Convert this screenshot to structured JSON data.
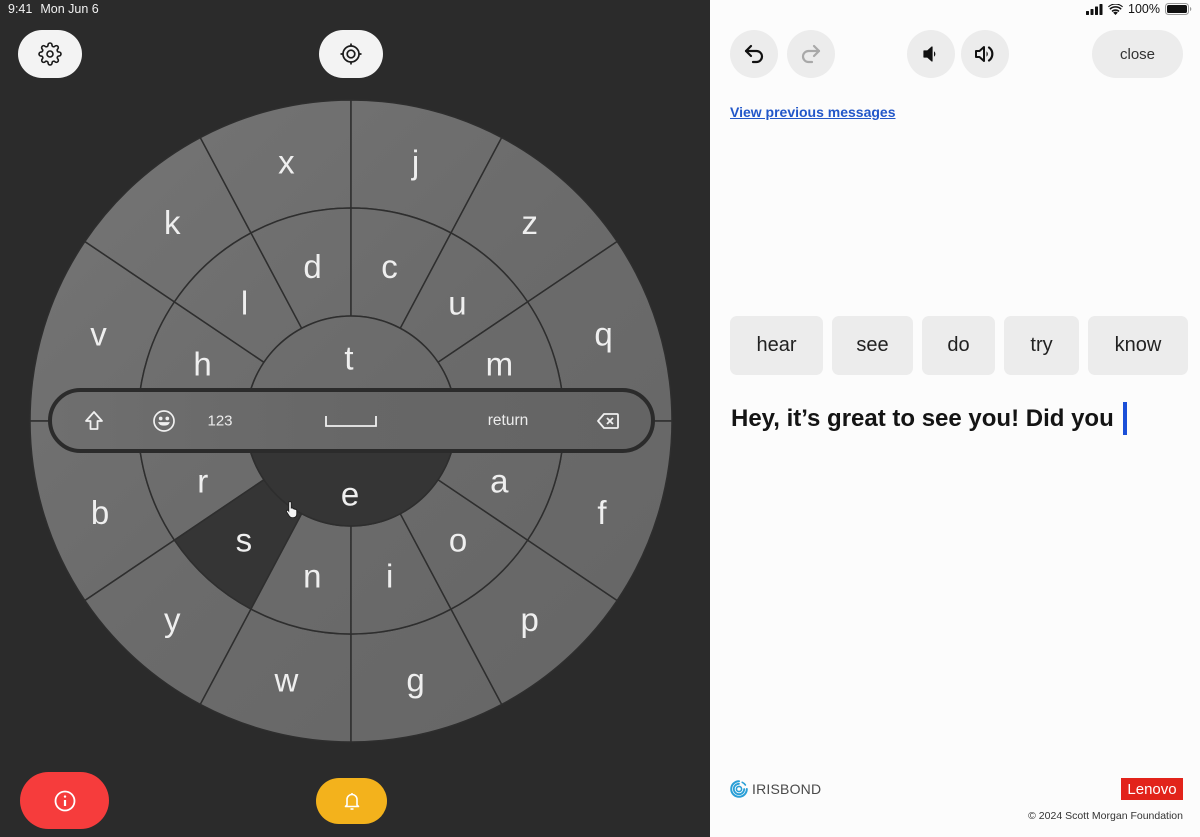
{
  "status_bar": {
    "time": "9:41",
    "date": "Mon Jun 6",
    "battery_percent": "100%",
    "icons": [
      "cellular-signal-icon",
      "wifi-icon",
      "battery-icon"
    ]
  },
  "left_panel": {
    "settings_button": {
      "icon": "gear-icon"
    },
    "recenter_button": {
      "icon": "target-icon"
    },
    "alert_button": {
      "icon": "info-icon"
    },
    "bell_button": {
      "icon": "bell-icon"
    }
  },
  "keyboard": {
    "inner": [
      "t",
      "e"
    ],
    "middle_top": [
      "h",
      "l",
      "d",
      "c",
      "u",
      "m"
    ],
    "middle_bottom": [
      "r",
      "s",
      "n",
      "i",
      "o",
      "a"
    ],
    "outer_top": [
      "v",
      "k",
      "x",
      "j",
      "z",
      "q"
    ],
    "outer_bottom": [
      "b",
      "y",
      "w",
      "g",
      "p",
      "f"
    ],
    "highlighted": [
      "e",
      "s"
    ],
    "toolbar": {
      "shift_icon": "shift-icon",
      "emoji_icon": "emoji-icon",
      "numbers_label": "123",
      "space_icon": "space-icon",
      "return_label": "return",
      "backspace_icon": "backspace-icon"
    }
  },
  "right_panel": {
    "toolbar": {
      "undo": {
        "icon": "undo-icon",
        "enabled": true
      },
      "redo": {
        "icon": "redo-icon",
        "enabled": false
      },
      "volume_down": {
        "icon": "volume-down-icon"
      },
      "volume_up": {
        "icon": "volume-up-icon"
      },
      "close_label": "close"
    },
    "history_link": "View previous messages",
    "suggestions": [
      "hear",
      "see",
      "do",
      "try",
      "know"
    ],
    "message_text": "Hey, it’s great to see you! Did you",
    "footer": {
      "partner_logo": "IRISBOND",
      "brand_logo": "Lenovo",
      "copyright": "© 2024 Scott Morgan Foundation"
    }
  },
  "colors": {
    "alert": "#f63c3c",
    "bell": "#f3b21c",
    "link": "#2257c9",
    "caret": "#1b4fd8",
    "lenovo": "#e2231a",
    "iris": "#2a9fd6",
    "key_highlight": "#353535",
    "pane_dark": "#2b2b2b"
  }
}
